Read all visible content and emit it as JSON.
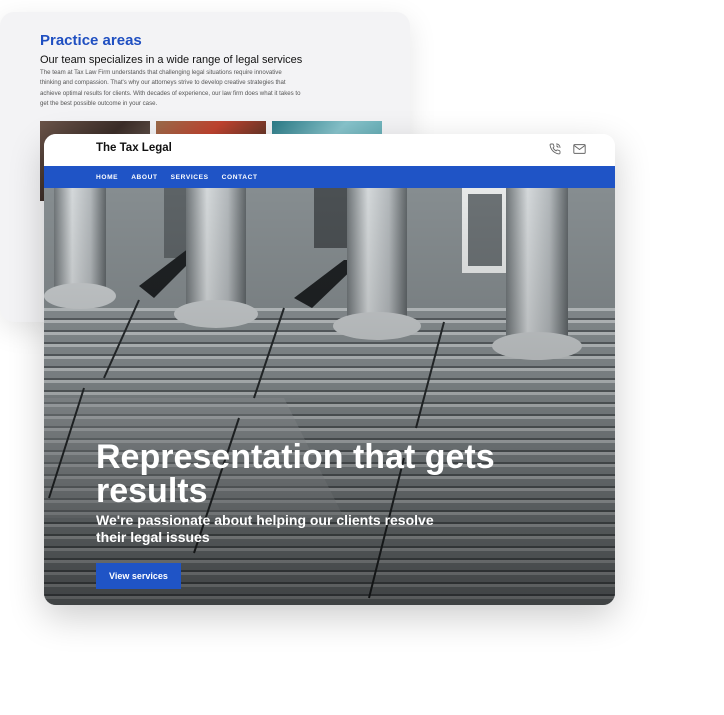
{
  "practice": {
    "title": "Practice areas",
    "subtitle": "Our team specializes in a wide range of legal services",
    "body": "The team at Tax Law Firm understands that challenging legal situations require innovative thinking and compassion. That's why our attorneys strive to develop creative strategies that achieve optimal results for clients. With decades of experience, our law firm does what it takes to get the best possible outcome in your case."
  },
  "site": {
    "brand": "The Tax Legal",
    "icons": [
      "phone-icon",
      "mail-icon"
    ],
    "nav": [
      "HOME",
      "ABOUT",
      "SERVICES",
      "CONTACT"
    ]
  },
  "hero": {
    "title": "Representation that gets results",
    "subtitle": "We're passionate about helping our clients resolve their legal issues",
    "button": "View services"
  },
  "colors": {
    "accent": "#1f54c6",
    "heading_blue": "#1f4fc1"
  }
}
